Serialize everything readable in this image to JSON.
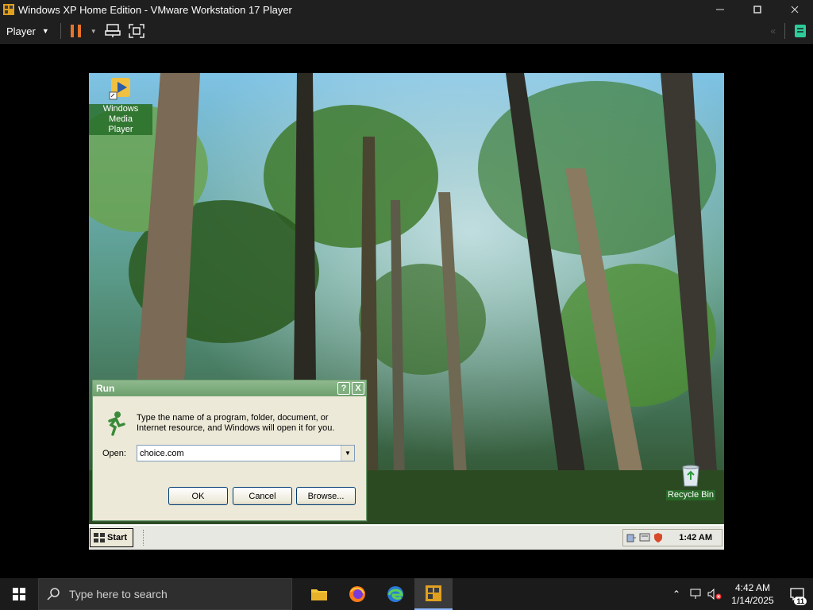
{
  "window": {
    "title": "Windows XP Home Edition - VMware Workstation 17 Player",
    "minimize_icon": "minimize-icon",
    "maximize_icon": "maximize-icon",
    "close_icon": "close-icon"
  },
  "toolbar": {
    "player_menu_label": "Player",
    "pause_color": "#e8742a"
  },
  "guest_desktop": {
    "icons": [
      {
        "label_line1": "Windows Media",
        "label_line2": "Player"
      },
      {
        "label_line1": "Recycle Bin"
      }
    ]
  },
  "run_dialog": {
    "title": "Run",
    "help_glyph": "?",
    "close_glyph": "X",
    "description": "Type the name of a program, folder, document, or Internet resource, and Windows will open it for you.",
    "open_label": "Open:",
    "open_value": "choice.com",
    "ok_label": "OK",
    "cancel_label": "Cancel",
    "browse_label": "Browse..."
  },
  "xp_taskbar": {
    "start_label": "Start",
    "clock": "1:42 AM"
  },
  "host_taskbar": {
    "search_placeholder": "Type here to search",
    "time": "4:42 AM",
    "date": "1/14/2025",
    "notification_count": "11",
    "pinned": [
      "file-explorer-icon",
      "firefox-icon",
      "edge-icon",
      "vmware-icon"
    ]
  }
}
